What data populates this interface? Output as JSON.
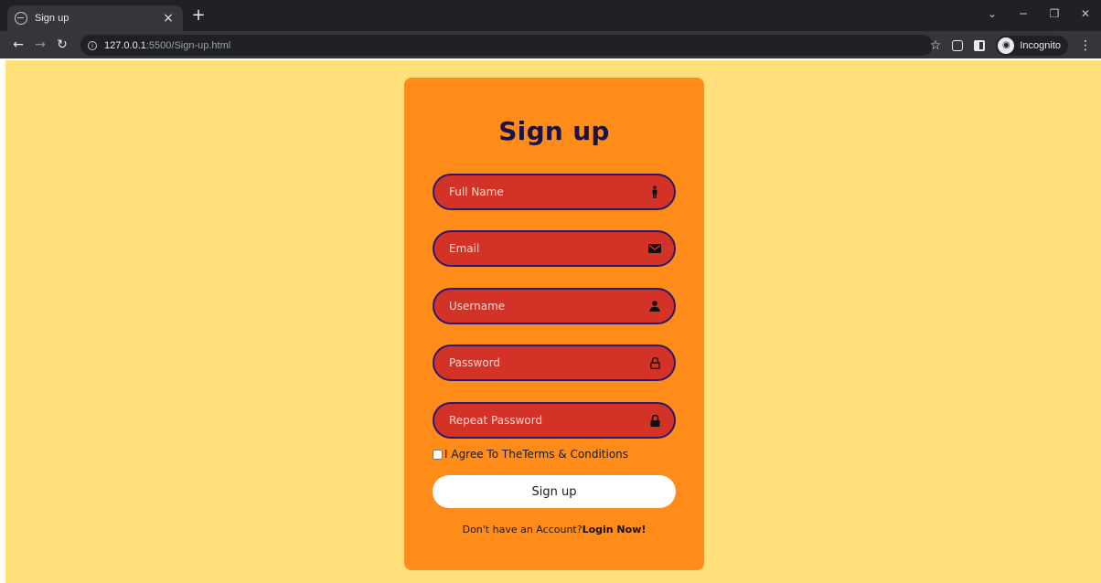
{
  "browser": {
    "tab_title": "Sign up",
    "tab_close": "×",
    "new_tab": "+",
    "url_host": "127.0.0.1",
    "url_path": ":5500/Sign-up.html",
    "incognito_label": "Incognito"
  },
  "form": {
    "title": "Sign up",
    "fields": [
      {
        "placeholder": "Full Name",
        "icon": "person-icon"
      },
      {
        "placeholder": "Email",
        "icon": "envelope-icon"
      },
      {
        "placeholder": "Username",
        "icon": "user-icon"
      },
      {
        "placeholder": "Password",
        "icon": "lock-open-icon"
      },
      {
        "placeholder": "Repeat Password",
        "icon": "lock-icon"
      }
    ],
    "agree_text": "I Agree To TheTerms & Conditions",
    "submit_label": "Sign up",
    "no_account_text": "Don't have an Account?",
    "login_link": "Login Now!"
  },
  "colors": {
    "page_bg": "#ffdf7a",
    "card_bg": "#ff8c19",
    "field_bg": "#d33227",
    "field_border": "#2a1770",
    "title_color": "#1b1346"
  }
}
